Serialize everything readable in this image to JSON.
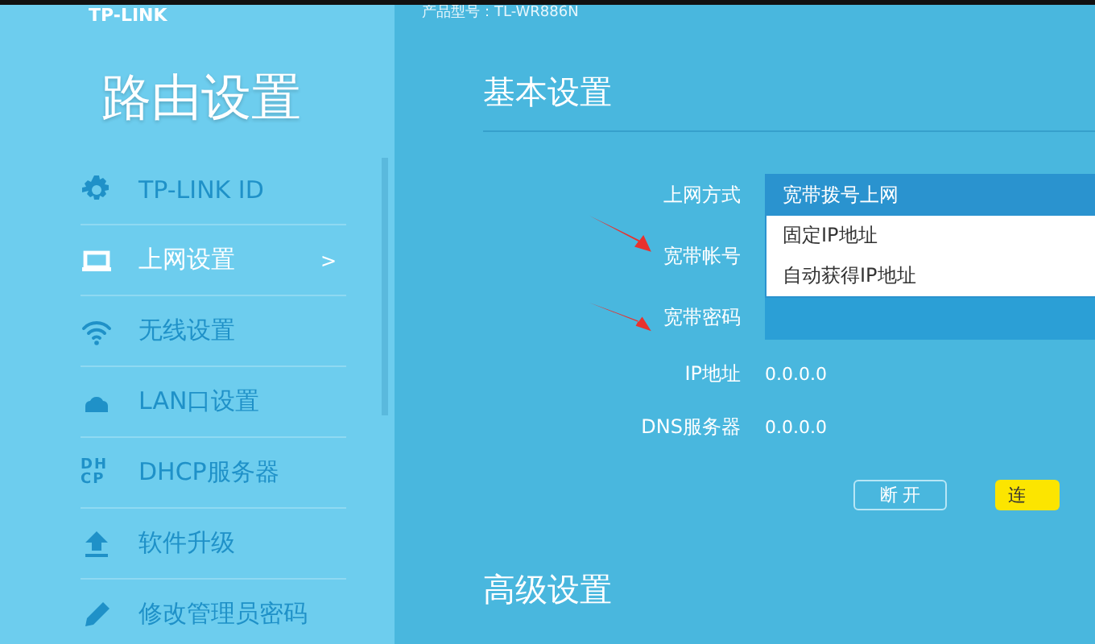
{
  "header": {
    "logo": "TP-LINK",
    "model": "产品型号：TL-WR886N"
  },
  "sidebar": {
    "title": "路由设置",
    "items": [
      {
        "kind": "gear",
        "label": "TP-LINK ID",
        "selected": false
      },
      {
        "kind": "laptop",
        "label": "上网设置",
        "selected": true,
        "chevron": ">"
      },
      {
        "kind": "wifi",
        "label": "无线设置",
        "selected": false
      },
      {
        "kind": "lan",
        "label": "LAN口设置",
        "selected": false
      },
      {
        "kind": "text",
        "icon_text": [
          "DH",
          "CP"
        ],
        "label": "DHCP服务器",
        "selected": false
      },
      {
        "kind": "upload",
        "label": "软件升级",
        "selected": false
      },
      {
        "kind": "pencil",
        "label": "修改管理员密码",
        "selected": false
      }
    ]
  },
  "basic": {
    "title": "基本设置",
    "fields": [
      {
        "kind": "select",
        "label": "上网方式",
        "options": [
          {
            "label": "宽带拨号上网",
            "selected": true
          },
          {
            "label": "固定IP地址",
            "selected": false
          },
          {
            "label": "自动获得IP地址",
            "selected": false
          }
        ]
      },
      {
        "kind": "covered",
        "label": "宽带帐号"
      },
      {
        "kind": "input",
        "label": "宽带密码"
      },
      {
        "kind": "value",
        "label": "IP地址",
        "value": "0.0.0.0"
      },
      {
        "kind": "value",
        "label": "DNS服务器",
        "value": "0.0.0.0"
      }
    ],
    "buttons": [
      {
        "kind": "outline",
        "label": "断 开"
      },
      {
        "kind": "primary",
        "label": "连"
      }
    ]
  },
  "advanced": {
    "title": "高级设置"
  }
}
